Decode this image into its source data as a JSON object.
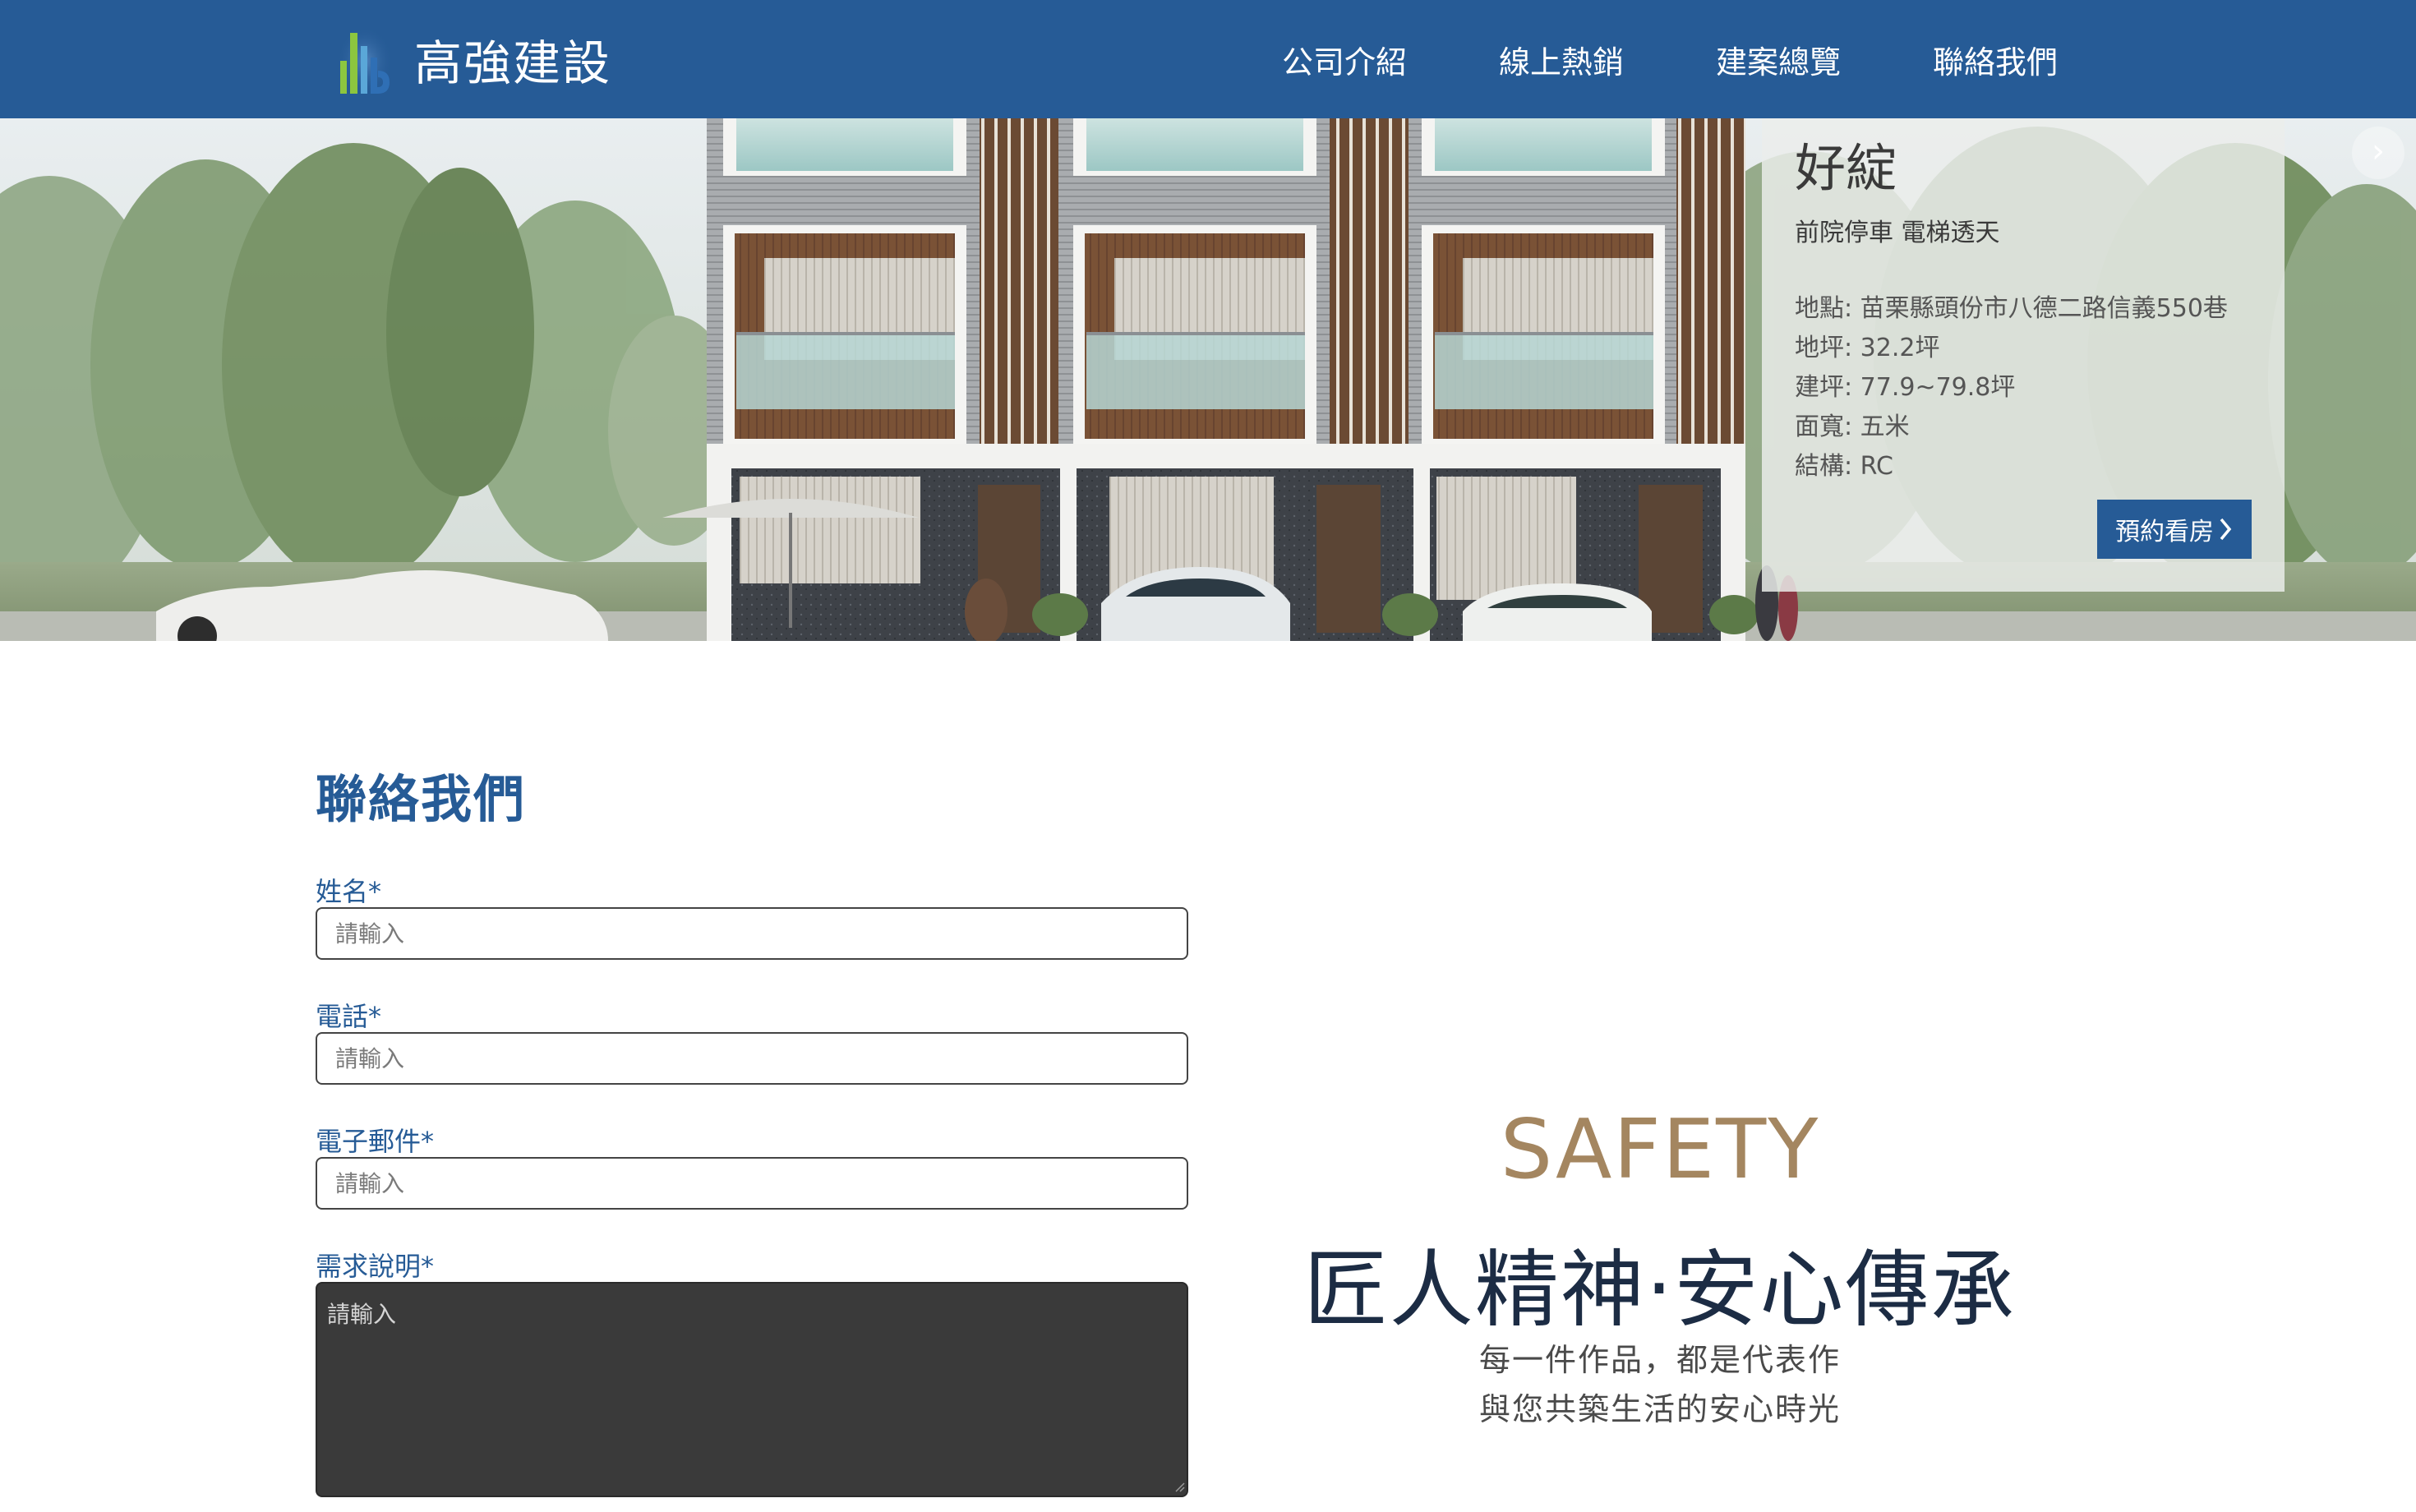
{
  "header": {
    "brand": "高強建設",
    "nav": [
      "公司介紹",
      "線上熱銷",
      "建案總覽",
      "聯絡我們"
    ]
  },
  "hero": {
    "project": {
      "name": "好綻",
      "tagline": "前院停車 電梯透天",
      "specs": [
        "地點: 苗栗縣頭份市八德二路信義550巷",
        "地坪: 32.2坪",
        "建坪: 77.9~79.8坪",
        "面寬: 五米",
        "結構: RC"
      ],
      "cta": "預約看房",
      "cta_icon": "chevron-right-icon"
    },
    "next_icon": "chevron-right-icon"
  },
  "contact": {
    "title": "聯絡我們",
    "fields": [
      {
        "label": "姓名*",
        "placeholder": "請輸入",
        "value": ""
      },
      {
        "label": "電話*",
        "placeholder": "請輸入",
        "value": ""
      },
      {
        "label": "電子郵件*",
        "placeholder": "請輸入",
        "value": ""
      },
      {
        "label": "需求說明*",
        "placeholder": "請輸入",
        "value": ""
      }
    ]
  },
  "slogan": {
    "en": "SAFETY",
    "zh": "匠人精神‧安心傳承",
    "lines": [
      "每一件作品，都是代表作",
      "與您共築生活的安心時光"
    ]
  },
  "colors": {
    "header_bg": "#265b96",
    "accent_gold": "#a48660",
    "slogan_dark": "#1c2c44",
    "textarea_bg": "#3a3a3a"
  }
}
